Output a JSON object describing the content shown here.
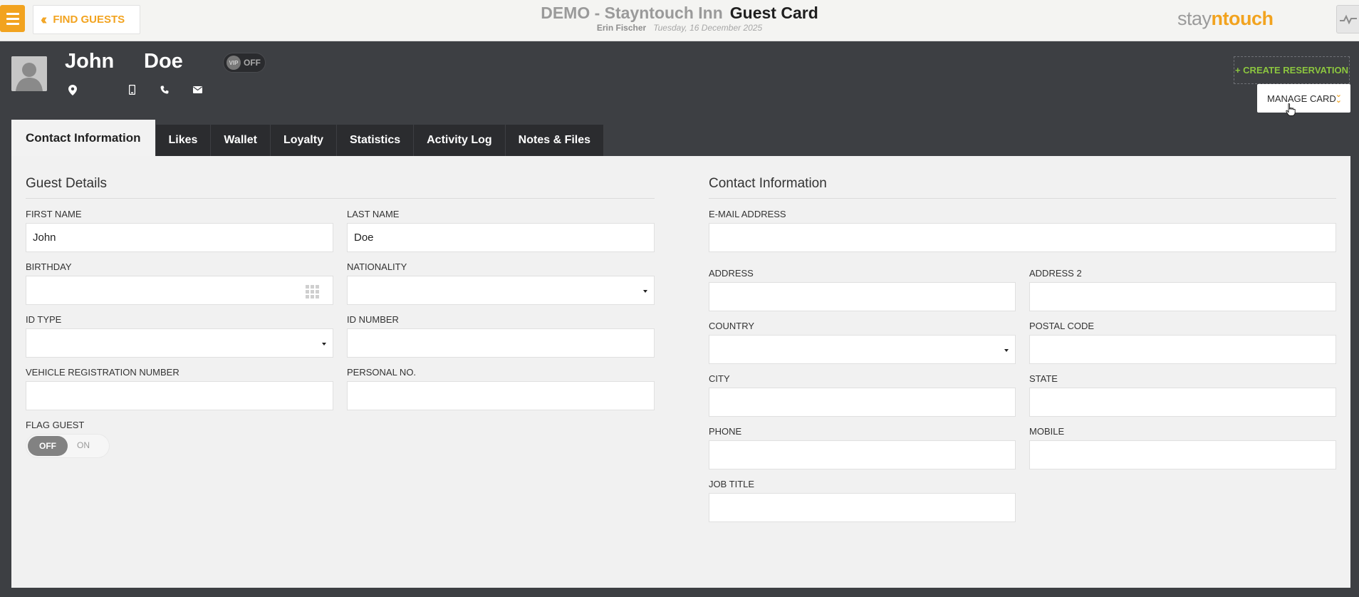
{
  "header": {
    "find_guests_label": "FIND GUESTS",
    "hotel_name": "DEMO - Stayntouch Inn",
    "page_title": "Guest Card",
    "user_name": "Erin Fischer",
    "date": "Tuesday, 16 December 2025",
    "logo_left": "stay",
    "logo_mid": "n",
    "logo_right": "touch"
  },
  "guest": {
    "first_name": "John",
    "last_name": "Doe",
    "vip_badge": "VIP",
    "vip_state": "OFF"
  },
  "actions": {
    "create_reservation": "+ CREATE RESERVATION",
    "manage_card": "MANAGE CARD"
  },
  "tabs": [
    {
      "label": "Contact Information",
      "active": true
    },
    {
      "label": "Likes"
    },
    {
      "label": "Wallet"
    },
    {
      "label": "Loyalty"
    },
    {
      "label": "Statistics"
    },
    {
      "label": "Activity Log"
    },
    {
      "label": "Notes & Files"
    }
  ],
  "guest_details": {
    "title": "Guest Details",
    "first_name_label": "FIRST NAME",
    "first_name_value": "John",
    "last_name_label": "LAST NAME",
    "last_name_value": "Doe",
    "birthday_label": "BIRTHDAY",
    "nationality_label": "NATIONALITY",
    "id_type_label": "ID TYPE",
    "id_number_label": "ID NUMBER",
    "vehicle_label": "VEHICLE REGISTRATION NUMBER",
    "personal_no_label": "PERSONAL NO.",
    "flag_guest_label": "FLAG GUEST",
    "flag_off": "OFF",
    "flag_on": "ON"
  },
  "contact_info": {
    "title": "Contact Information",
    "email_label": "E-MAIL ADDRESS",
    "address_label": "ADDRESS",
    "address2_label": "ADDRESS 2",
    "country_label": "COUNTRY",
    "postal_code_label": "POSTAL CODE",
    "city_label": "CITY",
    "state_label": "STATE",
    "phone_label": "PHONE",
    "mobile_label": "MOBILE",
    "job_title_label": "JOB TITLE"
  },
  "colors": {
    "accent": "#f2a31f",
    "create_green": "#8cc63f",
    "header_bg": "#3d3f43"
  }
}
